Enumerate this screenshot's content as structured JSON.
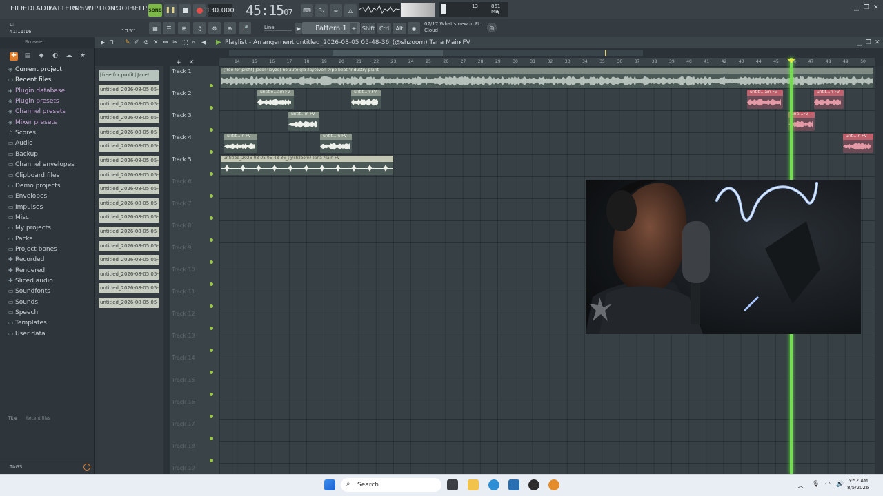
{
  "menu": [
    "FILE",
    "EDIT",
    "ADD",
    "PATTERNS",
    "VIEW",
    "OPTIONS",
    "TOOLS",
    "HELP"
  ],
  "transport": {
    "song_label": "SONG",
    "tempo": "130.000",
    "time_main": "45:15",
    "time_sub": "07",
    "time_small": "B:S:T"
  },
  "cpu": {
    "value": "13",
    "mem": "861 MB",
    "poly": "1"
  },
  "hint": {
    "line1": "L:",
    "line2": "41:11:16",
    "snap_label": "1'15''"
  },
  "toolbar": {
    "snap": "Line",
    "pattern": "Pattern 1",
    "keys": [
      "Shift",
      "Ctrl",
      "Alt"
    ]
  },
  "news": {
    "date": "07/17",
    "line1": "What's new in FL",
    "line2": "Cloud"
  },
  "browser": {
    "header": "Browser",
    "items": [
      {
        "label": "Current project",
        "icon": "project-icon"
      },
      {
        "label": "Recent files",
        "icon": "folder-icon"
      },
      {
        "label": "Plugin database",
        "icon": "plugin-icon"
      },
      {
        "label": "Plugin presets",
        "icon": "plugin-icon"
      },
      {
        "label": "Channel presets",
        "icon": "plugin-icon"
      },
      {
        "label": "Mixer presets",
        "icon": "plugin-icon"
      },
      {
        "label": "Scores",
        "icon": "note-icon"
      },
      {
        "label": "Audio",
        "icon": "folder-icon"
      },
      {
        "label": "Backup",
        "icon": "folder-icon"
      },
      {
        "label": "Channel envelopes",
        "icon": "folder-icon"
      },
      {
        "label": "Clipboard files",
        "icon": "folder-icon"
      },
      {
        "label": "Demo projects",
        "icon": "folder-icon"
      },
      {
        "label": "Envelopes",
        "icon": "folder-icon"
      },
      {
        "label": "Impulses",
        "icon": "folder-icon"
      },
      {
        "label": "Misc",
        "icon": "folder-icon"
      },
      {
        "label": "My projects",
        "icon": "folder-icon"
      },
      {
        "label": "Packs",
        "icon": "folder-icon"
      },
      {
        "label": "Project bones",
        "icon": "folder-icon"
      },
      {
        "label": "Recorded",
        "icon": "plus-icon"
      },
      {
        "label": "Rendered",
        "icon": "plus-icon"
      },
      {
        "label": "Sliced audio",
        "icon": "plus-icon"
      },
      {
        "label": "Soundfonts",
        "icon": "folder-icon"
      },
      {
        "label": "Sounds",
        "icon": "folder-icon"
      },
      {
        "label": "Speech",
        "icon": "folder-icon"
      },
      {
        "label": "Templates",
        "icon": "folder-icon"
      },
      {
        "label": "User data",
        "icon": "folder-icon"
      }
    ],
    "title": "Title",
    "subtitle": "Recent files",
    "tags": "TAGS"
  },
  "picker": {
    "first": "[free for profit] Jace!",
    "items": [
      "untitled_2026-08-05 05-",
      "untitled_2026-08-05 05-",
      "untitled_2026-08-05 05-",
      "untitled_2026-08-05 05-",
      "untitled_2026-08-05 05-",
      "untitled_2026-08-05 05-",
      "untitled_2026-08-05 05-",
      "untitled_2026-08-05 05-",
      "untitled_2026-08-05 05-",
      "untitled_2026-08-05 05-",
      "untitled_2026-08-05 05-",
      "untitled_2026-08-05 05-",
      "untitled_2026-08-05 05-",
      "untitled_2026-08-05 05-",
      "untitled_2026-08-05 05-",
      "untitled_2026-08-05 05-"
    ]
  },
  "playlist": {
    "title": "Playlist - Arrangement",
    "file": "untitled_2026-08-05 05-48-36_(@shzoom) Tana Main FV",
    "tracks": [
      "Track 1",
      "Track 2",
      "Track 3",
      "Track 4",
      "Track 5",
      "Track 6",
      "Track 7",
      "Track 8",
      "Track 9",
      "Track 10",
      "Track 11",
      "Track 12",
      "Track 13",
      "Track 14",
      "Track 15",
      "Track 16",
      "Track 17",
      "Track 18",
      "Track 19"
    ],
    "ruler": [
      "14",
      "15",
      "16",
      "17",
      "18",
      "19",
      "20",
      "21",
      "22",
      "23",
      "24",
      "25",
      "26",
      "27",
      "28",
      "29",
      "30",
      "31",
      "32",
      "33",
      "34",
      "35",
      "36",
      "37",
      "38",
      "39",
      "40",
      "41",
      "42",
      "43",
      "44",
      "45",
      "46",
      "47",
      "48",
      "49",
      "50"
    ],
    "clips": {
      "t1": "[free for profit] Jace! (iayze)  no auto  glo  zaytoven type beat 'industry plant'",
      "t2a": "untitle...ain FV",
      "t2b": "untit...n FV",
      "t3": "untit...in FV",
      "t4a": "untit...in FV",
      "t4b": "untit...in FV",
      "t5": "untitled_2026-08-05 05-48-36_(@shzoom) Tana Main FV",
      "r1": "untitl...ain FV",
      "r2": "untit...n FV",
      "r3": "unti...FV",
      "r4": "unti...n FV"
    }
  },
  "taskbar": {
    "search": "Search",
    "time": "5:52 AM",
    "date": "8/5/2026"
  }
}
